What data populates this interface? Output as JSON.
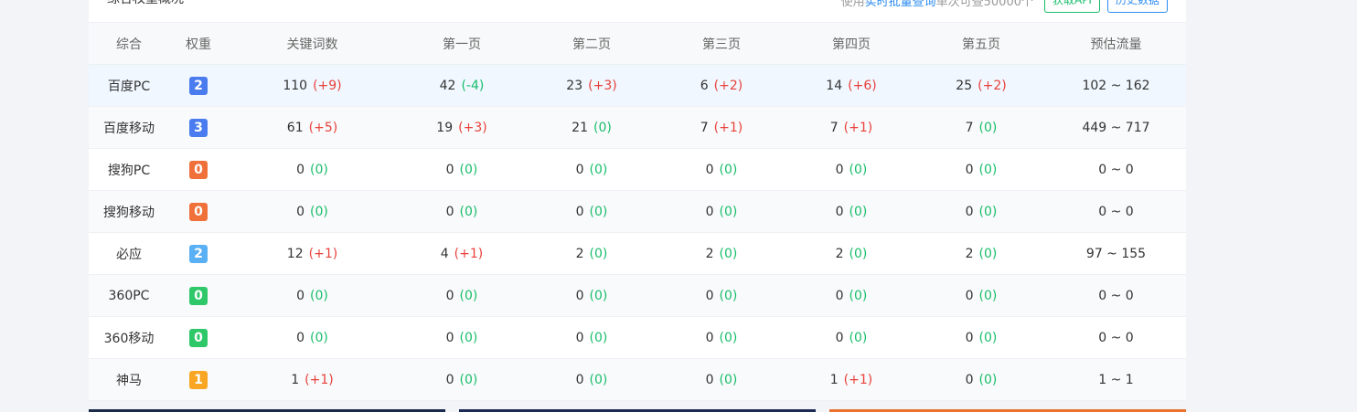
{
  "header": {
    "title": "综合权重概况",
    "note_prefix": "使用",
    "note_link": "实时批量查询",
    "note_suffix": "单次可查50000个",
    "api_button": "获取API",
    "history_button": "历史数据"
  },
  "columns": [
    "综合",
    "权重",
    "关键词数",
    "第一页",
    "第二页",
    "第三页",
    "第四页",
    "第五页",
    "预估流量"
  ],
  "colors": {
    "badge_blue": "#4a7cf0",
    "badge_orange": "#f0703a",
    "badge_lightblue": "#5ab0f5",
    "badge_green": "#2ec869",
    "badge_yellow": "#f8a624",
    "delta_up": "#e8413b",
    "delta_down": "#19be6b",
    "accent": "#2d8cf0"
  },
  "rows": [
    {
      "engine": "百度PC",
      "weight": "2",
      "badge_color": "#4a7cf0",
      "cells": [
        [
          "110",
          "(+9)",
          "up"
        ],
        [
          "42",
          "(-4)",
          "dn"
        ],
        [
          "23",
          "(+3)",
          "up"
        ],
        [
          "6",
          "(+2)",
          "up"
        ],
        [
          "14",
          "(+6)",
          "up"
        ],
        [
          "25",
          "(+2)",
          "up"
        ]
      ],
      "traffic": "102 ~ 162"
    },
    {
      "engine": "百度移动",
      "weight": "3",
      "badge_color": "#4a7cf0",
      "cells": [
        [
          "61",
          "(+5)",
          "up"
        ],
        [
          "19",
          "(+3)",
          "up"
        ],
        [
          "21",
          "(0)",
          "zero"
        ],
        [
          "7",
          "(+1)",
          "up"
        ],
        [
          "7",
          "(+1)",
          "up"
        ],
        [
          "7",
          "(0)",
          "zero"
        ]
      ],
      "traffic": "449 ~ 717"
    },
    {
      "engine": "搜狗PC",
      "weight": "0",
      "badge_color": "#f0703a",
      "cells": [
        [
          "0",
          "(0)",
          "zero"
        ],
        [
          "0",
          "(0)",
          "zero"
        ],
        [
          "0",
          "(0)",
          "zero"
        ],
        [
          "0",
          "(0)",
          "zero"
        ],
        [
          "0",
          "(0)",
          "zero"
        ],
        [
          "0",
          "(0)",
          "zero"
        ]
      ],
      "traffic": "0 ~ 0"
    },
    {
      "engine": "搜狗移动",
      "weight": "0",
      "badge_color": "#f0703a",
      "cells": [
        [
          "0",
          "(0)",
          "zero"
        ],
        [
          "0",
          "(0)",
          "zero"
        ],
        [
          "0",
          "(0)",
          "zero"
        ],
        [
          "0",
          "(0)",
          "zero"
        ],
        [
          "0",
          "(0)",
          "zero"
        ],
        [
          "0",
          "(0)",
          "zero"
        ]
      ],
      "traffic": "0 ~ 0"
    },
    {
      "engine": "必应",
      "weight": "2",
      "badge_color": "#5ab0f5",
      "cells": [
        [
          "12",
          "(+1)",
          "up"
        ],
        [
          "4",
          "(+1)",
          "up"
        ],
        [
          "2",
          "(0)",
          "zero"
        ],
        [
          "2",
          "(0)",
          "zero"
        ],
        [
          "2",
          "(0)",
          "zero"
        ],
        [
          "2",
          "(0)",
          "zero"
        ]
      ],
      "traffic": "97 ~ 155"
    },
    {
      "engine": "360PC",
      "weight": "0",
      "badge_color": "#2ec869",
      "cells": [
        [
          "0",
          "(0)",
          "zero"
        ],
        [
          "0",
          "(0)",
          "zero"
        ],
        [
          "0",
          "(0)",
          "zero"
        ],
        [
          "0",
          "(0)",
          "zero"
        ],
        [
          "0",
          "(0)",
          "zero"
        ],
        [
          "0",
          "(0)",
          "zero"
        ]
      ],
      "traffic": "0 ~ 0"
    },
    {
      "engine": "360移动",
      "weight": "0",
      "badge_color": "#2ec869",
      "cells": [
        [
          "0",
          "(0)",
          "zero"
        ],
        [
          "0",
          "(0)",
          "zero"
        ],
        [
          "0",
          "(0)",
          "zero"
        ],
        [
          "0",
          "(0)",
          "zero"
        ],
        [
          "0",
          "(0)",
          "zero"
        ],
        [
          "0",
          "(0)",
          "zero"
        ]
      ],
      "traffic": "0 ~ 0"
    },
    {
      "engine": "神马",
      "weight": "1",
      "badge_color": "#f8a624",
      "cells": [
        [
          "1",
          "(+1)",
          "up"
        ],
        [
          "0",
          "(0)",
          "zero"
        ],
        [
          "0",
          "(0)",
          "zero"
        ],
        [
          "0",
          "(0)",
          "zero"
        ],
        [
          "1",
          "(+1)",
          "up"
        ],
        [
          "0",
          "(0)",
          "zero"
        ]
      ],
      "traffic": "1 ~ 1"
    }
  ],
  "banners": [
    {
      "color": "#1a2a4a"
    },
    {
      "color": "#1c2b55"
    },
    {
      "color": "#e8722e"
    }
  ]
}
